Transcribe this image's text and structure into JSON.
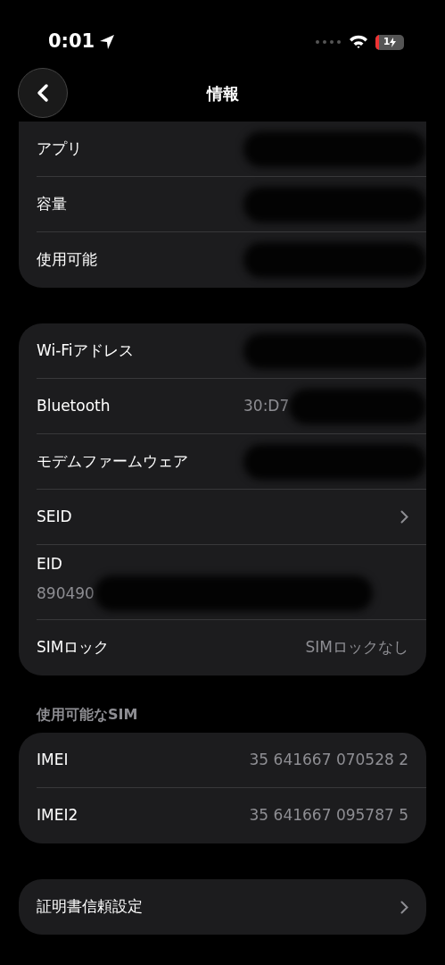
{
  "status_bar": {
    "time": "0:01",
    "battery_text": "1"
  },
  "nav": {
    "title": "情報"
  },
  "sections": [
    {
      "rows": [
        {
          "kind": "value",
          "label": "アプリ",
          "redacted": true
        },
        {
          "kind": "value",
          "label": "容量",
          "redacted": true
        },
        {
          "kind": "value",
          "label": "使用可能",
          "redacted": true
        }
      ]
    },
    {
      "rows": [
        {
          "kind": "value",
          "label": "Wi-Fiアドレス",
          "redacted": true
        },
        {
          "kind": "value",
          "label": "Bluetooth",
          "value": "30:D7",
          "redacted": true
        },
        {
          "kind": "value",
          "label": "モデムファームウェア",
          "redacted": true
        },
        {
          "kind": "chevron",
          "label": "SEID"
        },
        {
          "kind": "stacked",
          "label": "EID",
          "value": "890490",
          "redacted": true
        },
        {
          "kind": "value",
          "label": "SIMロック",
          "value": "SIMロックなし",
          "redacted": false
        }
      ]
    },
    {
      "header": "使用可能なSIM",
      "rows": [
        {
          "kind": "value",
          "label": "IMEI",
          "value": "35 641667 070528 2",
          "redacted": false
        },
        {
          "kind": "value",
          "label": "IMEI2",
          "value": "35 641667 095787 5",
          "redacted": false
        }
      ]
    },
    {
      "rows": [
        {
          "kind": "chevron",
          "label": "証明書信頼設定"
        }
      ]
    }
  ]
}
